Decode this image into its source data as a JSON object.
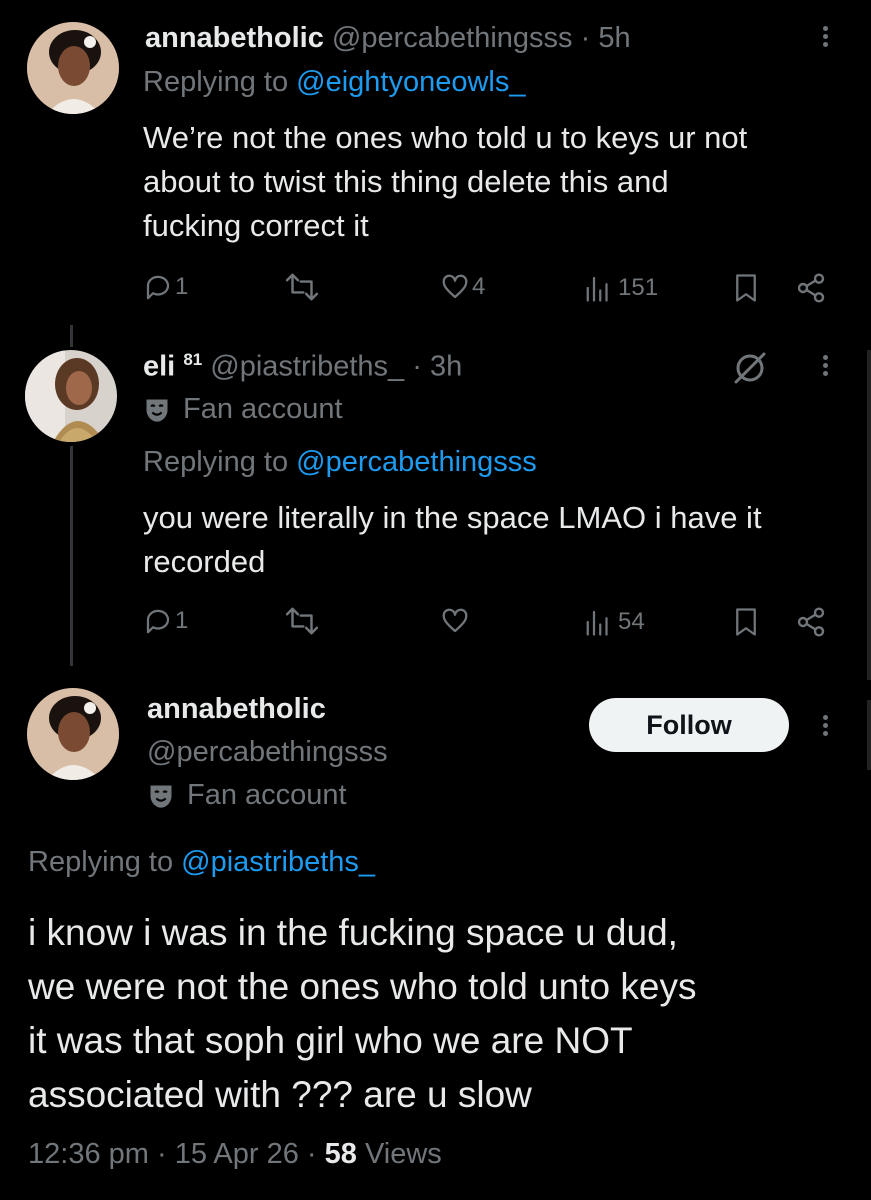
{
  "tweets": [
    {
      "display_name": "annabetholic",
      "handle": "@percabethingsss",
      "time": "· 5h",
      "replying_label": "Replying to",
      "replying_to": "@eightyoneowls_",
      "text_lines": [
        "We’re not the ones who told u to keys ur not",
        "about to twist this thing delete this and",
        "fucking correct it"
      ],
      "replies": "1",
      "likes": "4",
      "views": "151"
    },
    {
      "display_name": "eli",
      "name_superscript": "81",
      "handle": "@piastribeths_",
      "time": "· 3h",
      "label": "Fan account",
      "replying_label": "Replying to",
      "replying_to": "@percabethingsss",
      "text_lines": [
        "you were literally in the space LMAO i have it",
        "recorded"
      ],
      "replies": "1",
      "likes": "",
      "views": "54"
    }
  ],
  "main": {
    "display_name": "annabetholic",
    "handle": "@percabethingsss",
    "label": "Fan account",
    "follow_label": "Follow",
    "replying_label": "Replying to",
    "replying_to": "@piastribeths_",
    "text_lines": [
      "i know i was in the fucking space u dud,",
      "we were not the ones who told unto keys",
      "it was that soph girl who we are NOT",
      "associated with ??? are u slow"
    ],
    "time": "12:36 pm",
    "date": "15 Apr 26",
    "views_count": "58",
    "views_label": "Views"
  },
  "colors": {
    "link": "#1d9bf0",
    "muted": "#71767b",
    "text": "#e7e9ea",
    "background": "#000000"
  },
  "icons": [
    "reply-icon",
    "retweet-icon",
    "like-icon",
    "views-icon",
    "bookmark-icon",
    "share-icon",
    "more-icon",
    "mask-icon",
    "grok-icon"
  ]
}
